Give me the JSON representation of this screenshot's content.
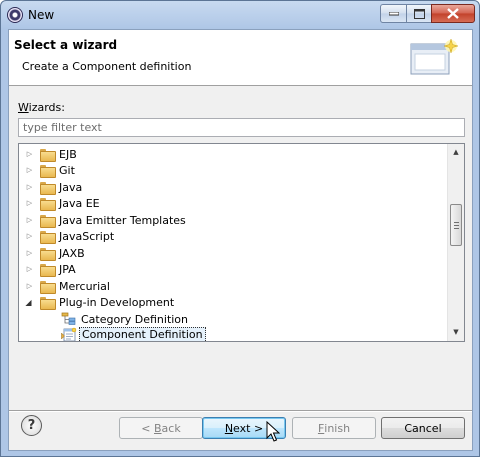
{
  "window": {
    "title": "New",
    "icon": "eclipse-new-wizard-icon"
  },
  "header": {
    "title": "Select a wizard",
    "description": "Create a Component definition",
    "banner_icon": "wizard-banner-icon"
  },
  "wizards": {
    "label_prefix": "W",
    "label_rest": "izards:",
    "filter_placeholder": "type filter text",
    "filter_value": ""
  },
  "tree": {
    "items": [
      {
        "label": "EJB",
        "expanded": false,
        "icon": "folder-icon"
      },
      {
        "label": "Git",
        "expanded": false,
        "icon": "folder-icon"
      },
      {
        "label": "Java",
        "expanded": false,
        "icon": "folder-icon"
      },
      {
        "label": "Java EE",
        "expanded": false,
        "icon": "folder-icon"
      },
      {
        "label": "Java Emitter Templates",
        "expanded": false,
        "icon": "folder-icon"
      },
      {
        "label": "JavaScript",
        "expanded": false,
        "icon": "folder-icon"
      },
      {
        "label": "JAXB",
        "expanded": false,
        "icon": "folder-icon"
      },
      {
        "label": "JPA",
        "expanded": false,
        "icon": "folder-icon"
      },
      {
        "label": "Mercurial",
        "expanded": false,
        "icon": "folder-icon"
      },
      {
        "label": "Plug-in Development",
        "expanded": true,
        "icon": "folder-icon"
      }
    ],
    "children": [
      {
        "label": "Category Definition",
        "icon": "category-definition-icon",
        "selected": false
      },
      {
        "label": "Component Definition",
        "icon": "component-definition-icon",
        "selected": true
      }
    ],
    "scroll_position": 0.45
  },
  "buttons": {
    "back_prefix": "< ",
    "back_mnemonic": "B",
    "back_rest": "ack",
    "next_mnemonic": "N",
    "next_rest": "ext >",
    "finish_mnemonic": "F",
    "finish_rest": "inish",
    "cancel": "Cancel",
    "help": "?"
  },
  "colors": {
    "selection": "#e5f1fb",
    "default_button": "#bee6fd",
    "title_bar": "#c8daf0"
  }
}
